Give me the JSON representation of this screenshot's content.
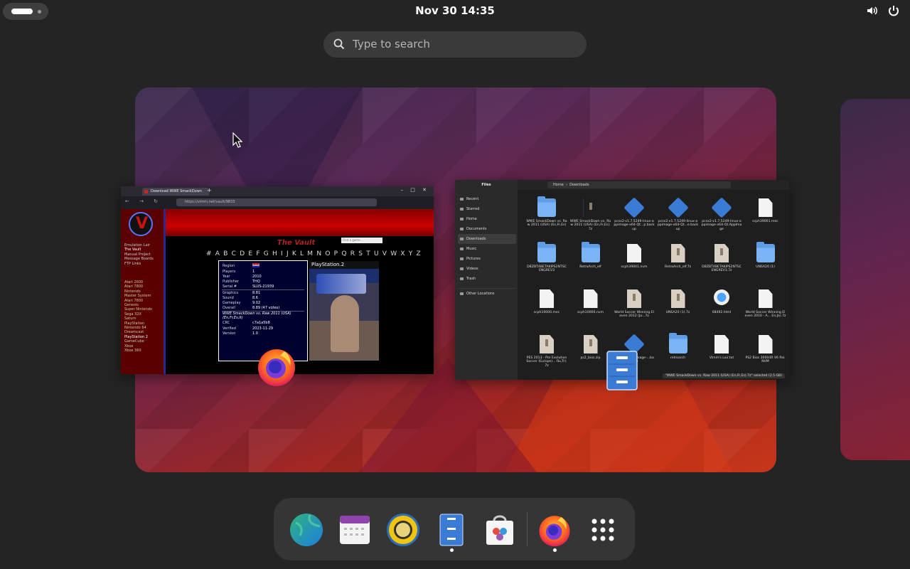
{
  "topbar": {
    "clock": "Nov 30  14:35",
    "system_icons": [
      "volume-icon",
      "power-icon"
    ]
  },
  "search": {
    "placeholder": "Type to search"
  },
  "browser_window": {
    "tab_title": "Download WWE SmackDown",
    "url": "https://vimm.net/vault/9833",
    "page": {
      "site_title": "The Vault",
      "search_placeholder": "Find a game...",
      "search_advanced": "Advanced",
      "nav_links": [
        "Emulation Lair",
        "The Vault",
        "Manual Project",
        "Message Boards",
        "FTP Links"
      ],
      "system_links": [
        "Atari 2600",
        "Atari 7800",
        "Nintendo",
        "Master System",
        "Atari 7800",
        "Genesis",
        "Super Nintendo",
        "Sega 32X",
        "Saturn",
        "PlayStation",
        "Nintendo 64",
        "Dreamcast",
        "PlayStation 2",
        "GameCube",
        "Xbox",
        "Xbox 360"
      ],
      "alphabet": "# A B C D E F G H I J K L M N O P Q R S T U V W X Y Z",
      "info": [
        {
          "label": "Region",
          "value": ""
        },
        {
          "label": "Players",
          "value": "1"
        },
        {
          "label": "Year",
          "value": "2010"
        },
        {
          "label": "Publisher",
          "value": "THQ"
        },
        {
          "label": "Serial #",
          "value": "SLUS-21939"
        },
        {
          "label": "Graphics",
          "value": "8.81"
        },
        {
          "label": "Sound",
          "value": "8.6"
        },
        {
          "label": "Gameplay",
          "value": "9.02"
        },
        {
          "label": "Overall",
          "value": "8.89 (47 votes)"
        },
        {
          "label": "",
          "value": "WWE SmackDown vs. Raw 2011 (USA) (En,Fr,Es,It)"
        },
        {
          "label": "CRC",
          "value": "c7a1a5b8"
        },
        {
          "label": "Verified",
          "value": "2023-11-29"
        },
        {
          "label": "Version",
          "value": "1.0"
        }
      ],
      "cover_platform": "PlayStation.2"
    }
  },
  "files_window": {
    "title": "Files",
    "path": [
      "Home",
      "Downloads"
    ],
    "sidebar": [
      "Recent",
      "Starred",
      "Home",
      "Documents",
      "Downloads",
      "Music",
      "Pictures",
      "Videos",
      "Trash",
      "Other Locations"
    ],
    "selected_sidebar": "Downloads",
    "items": [
      {
        "name": "WWE SmackDown vs. Raw 2011 (USA) (En,Fr,Es)",
        "type": "folder"
      },
      {
        "name": "WWE SmackDown vs. Raw 2011 (USA) (En,Fr,Es).7z",
        "type": "archive",
        "selected": true
      },
      {
        "name": "pcsx2-v1.7.5249-linux-appimage-x64-Qt...p.backup",
        "type": "app"
      },
      {
        "name": "pcsx2-v1.7.5249-linux-appimage-x64-Qt...e.backup",
        "type": "app"
      },
      {
        "name": "pcsx2-v1.7.5249-linux-appimage-x64-Qt.AppImage",
        "type": "app"
      },
      {
        "name": "scph39001.mec",
        "type": "doc"
      },
      {
        "name": "DBZBT4BETAKIPS2NTSCENGREV3",
        "type": "folder"
      },
      {
        "name": "RetroArch_elf",
        "type": "folder"
      },
      {
        "name": "scph39001.nvm",
        "type": "doc"
      },
      {
        "name": "RetroArch_elf.7z",
        "type": "archive"
      },
      {
        "name": "DBZBT4BETAKIPS2NTSCENGREV3.7z",
        "type": "archive"
      },
      {
        "name": "UNSA20 (1)",
        "type": "folder"
      },
      {
        "name": "scph10000.mec",
        "type": "doc"
      },
      {
        "name": "scph10000.nvm",
        "type": "doc"
      },
      {
        "name": "World Soccer Winning Eleven 2012 (Ja...7z",
        "type": "archive"
      },
      {
        "name": "UNSA20 (1).7z",
        "type": "archive"
      },
      {
        "name": "68492.html",
        "type": "web"
      },
      {
        "name": "World Soccer Winning Eleven 2010 - A... En,Ja).7z",
        "type": "doc"
      },
      {
        "name": "PES 2013 - Pro Evolution Soccer (Europe)... Ru,Tr).7z",
        "type": "archive"
      },
      {
        "name": "ps2_bios.zip",
        "type": "archive"
      },
      {
        "name": "...265-...-appimage-...backup",
        "type": "app"
      },
      {
        "name": "retroarch",
        "type": "folder"
      },
      {
        "name": "Vimm's Lair.txt",
        "type": "doc"
      },
      {
        "name": "PS2 Bios 30004R V6 Pal.NVM",
        "type": "doc"
      }
    ],
    "status": "\"WWE SmackDown vs. Raw 2011 (USA) (En,Fr,Es).7z\" selected (2.5 GB)"
  },
  "dock": {
    "items": [
      {
        "name": "browser-globe-icon",
        "running": false
      },
      {
        "name": "calendar-icon",
        "running": false
      },
      {
        "name": "music-player-icon",
        "running": false
      },
      {
        "name": "files-icon",
        "running": true
      },
      {
        "name": "software-store-icon",
        "running": false
      },
      {
        "name": "firefox-icon",
        "running": true
      },
      {
        "name": "app-grid-icon",
        "running": false
      }
    ]
  },
  "colors": {
    "shell_bg": "#242424",
    "dock_bg": "#353535",
    "search_bg": "#3a3a3a",
    "accent_blue": "#3a7bd5"
  }
}
